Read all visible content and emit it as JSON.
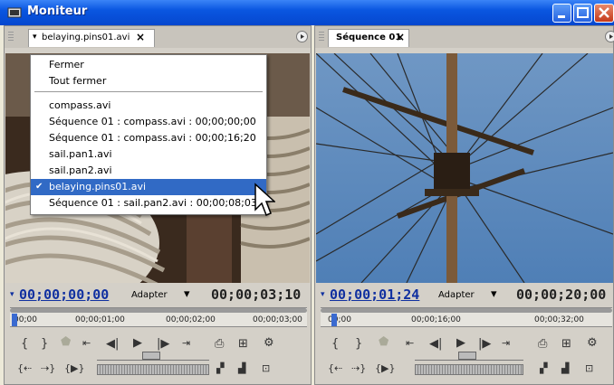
{
  "window": {
    "title": "Moniteur"
  },
  "source_monitor": {
    "tab_label": "belaying.pins01.avi",
    "timecode_current": "00;00;00;00",
    "fit_label": "Adapter",
    "timecode_duration": "00;00;03;10",
    "ruler_marks": [
      "00;00",
      "00;00;01;00",
      "00;00;02;00",
      "00;00;03;00"
    ]
  },
  "program_monitor": {
    "tab_label": "Séquence 01",
    "timecode_current": "00;00;01;24",
    "fit_label": "Adapter",
    "timecode_duration": "00;00;20;00",
    "ruler_marks": [
      "00;00",
      "00;00;16;00",
      "00;00;32;00"
    ]
  },
  "menu": {
    "items": [
      {
        "label": "Fermer"
      },
      {
        "label": "Tout fermer"
      },
      {
        "label": "compass.avi"
      },
      {
        "label": "Séquence 01 : compass.avi : 00;00;00;00"
      },
      {
        "label": "Séquence 01 : compass.avi : 00;00;16;20"
      },
      {
        "label": "sail.pan1.avi"
      },
      {
        "label": "sail.pan2.avi"
      },
      {
        "label": "belaying.pins01.avi",
        "checked": true
      },
      {
        "label": "Séquence 01 : sail.pan2.avi : 00;00;08;03"
      }
    ]
  },
  "glyphs": {
    "close": "×",
    "check": "✔",
    "dropdown": "▾"
  },
  "colors": {
    "accent": "#316ac5",
    "titlebar": "#0a56e0",
    "timecode": "#1030a0"
  }
}
